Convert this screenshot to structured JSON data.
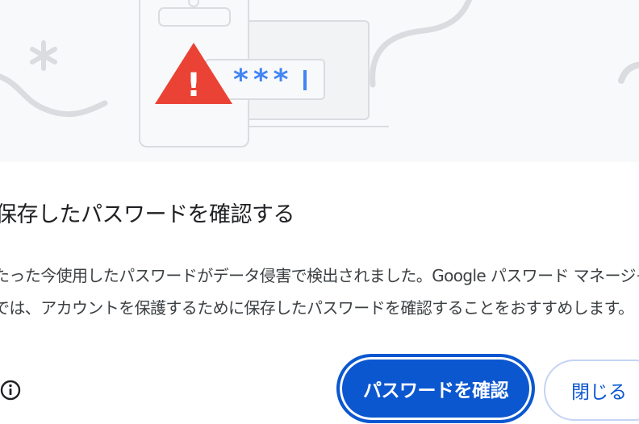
{
  "illustration": {
    "password_mask": "***",
    "warning_symbol": "!"
  },
  "dialog": {
    "title": "保存したパスワードを確認する",
    "description_line1": "たった今使用したパスワードがデータ侵害で検出されました。Google パスワード マネージャー",
    "description_line2": "では、アカウントを保護するために保存したパスワードを確認することをおすすめします。",
    "info_icon": "info-icon",
    "primary_button": "パスワードを確認",
    "secondary_button": "閉じる"
  },
  "colors": {
    "accent": "#0b57d0",
    "warning": "#ea4335",
    "password_dots": "#4285f4",
    "banner_bg": "#f8f9fa"
  }
}
